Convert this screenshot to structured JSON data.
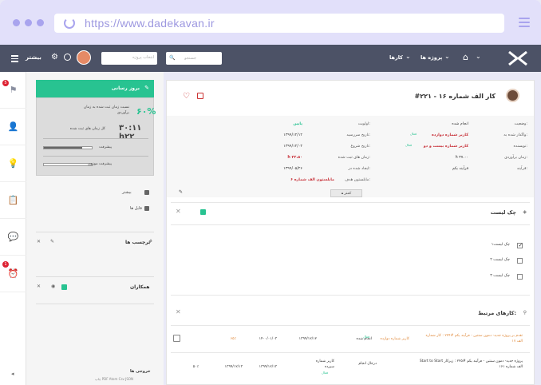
{
  "browser": {
    "url": "https://www.dadekavan.ir"
  },
  "navbar": {
    "more_label": "بیشتر",
    "select_placeholder": "انتخاب پروژه",
    "search_placeholder": "جستجو",
    "tasks_label": "کارها",
    "projects_label": "پروژه ها"
  },
  "iconbar": {
    "badges": [
      "5",
      "1"
    ]
  },
  "sidebar": {
    "update_label": "بروز رسانی",
    "percent": "۶۰%",
    "percent_label": "نسبت زمان ثبت شده به زمان برآوردی",
    "logged_time": "۳۰:۱۱ h۲۲",
    "logged_label": "کل زمان های ثبت شده",
    "progress_label": "پیشرفت",
    "progress_value": 0.8,
    "weighted_label": "پیشرفت موزون",
    "weighted_value": 0.0,
    "more_label": "بیشتر",
    "files_label": "فایل ها",
    "tags_title": "برچسب ها",
    "colleagues_title": "همکاران",
    "exports_title": "خروجی ها",
    "exports_list": "چاپ PDF Atom Csv JSON"
  },
  "task": {
    "title": "#۲۲۱ - کار الف شماره ۱۶",
    "fields_right": [
      {
        "label": "وضعیت:",
        "value": "انجام شده"
      },
      {
        "label": "واگذار شده به:",
        "value": "کاربر شماره دوازده"
      },
      {
        "label": "نویسنده:",
        "value": "کاربر شماره بیست و دو"
      },
      {
        "label": "زمان برآوردی:",
        "value": "h ۳۷.۰۰"
      },
      {
        "label": "فرآیند:",
        "value": "فرآیند یکم"
      }
    ],
    "fields_left": [
      {
        "label": "اولویت:",
        "value": "پایین"
      },
      {
        "label": "تاریخ سررسید:",
        "value": "۱۳۹۹/۱۲/۱۲"
      },
      {
        "label": "تاریخ شروع:",
        "value": "۱۳۹۹/۱۲/۰۴"
      },
      {
        "label": "زمان های ثبت شده:",
        "value": "h ۲۲.۵۰"
      },
      {
        "label": "ایجاد شده در:",
        "value": "۱۳۹۹/۰۵/۲۶"
      },
      {
        "label": "مایلستون هدف:",
        "value": "مایلستون الف شماره ۶"
      }
    ],
    "status_tag": "فعال",
    "more_btn": "کمتر"
  },
  "checklist": {
    "title": "چک لیست",
    "items": [
      {
        "label": "چک لیست۱",
        "checked": true
      },
      {
        "label": "چک لیست ۲",
        "checked": false
      },
      {
        "label": "چک لیست ۳",
        "checked": false
      }
    ]
  },
  "related": {
    "title": "کارهای مرتبط:",
    "rows": [
      {
        "task": "تقدم بر پروژه جدید- دمون سنتین - فرآیند یکم #۲۲۴ : کار شماره الف ۱۷",
        "status": "انجام شده",
        "user": "کاربر شماره دوازده",
        "tag": "فعال",
        "date1": "۱۳۹۹/۱۲/۱۲",
        "date2": "۱۴۰۰/۰۱/۰۳",
        "pct": "۶۵٪",
        "desc": "Start to Start",
        "time": "۳۰:۱۱"
      },
      {
        "task": "Start to Start پروژه جدید- دمون سنتین - فرآیند یکم #۲۲۵ : زیرکار الف شماره ۱۶۱",
        "status": "درحال انجام",
        "user": "کاربر شماره سیزده",
        "tag": "فعال",
        "date1": "۱۳۹۹/۱۲/۱۳",
        "date2": "۱۳۹۹/۱۲/۱۳",
        "pct": "۵۰٪",
        "desc": "",
        "time": ""
      }
    ]
  },
  "colors": {
    "accent": "#28c391",
    "navbar": "#4c5266",
    "red": "#c8323a",
    "browser": "#e2e0fa"
  }
}
